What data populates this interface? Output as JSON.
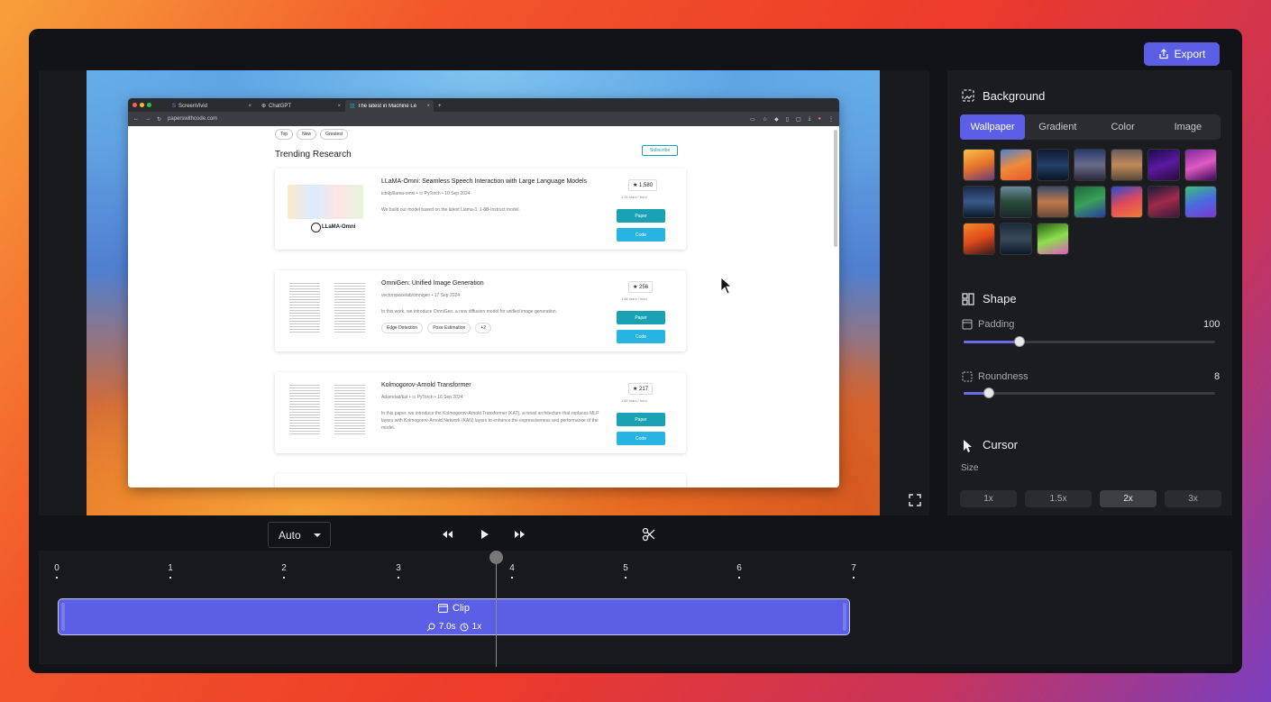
{
  "toolbar": {
    "export_label": "Export"
  },
  "browser": {
    "tabs": [
      {
        "label": "ScreenVivid",
        "icon": "screenvivid-icon"
      },
      {
        "label": "ChatGPT",
        "icon": "chatgpt-icon"
      },
      {
        "label": "The latest in Machine Le",
        "icon": "pwc-icon"
      }
    ],
    "url": "paperswithcode.com"
  },
  "page": {
    "filters": [
      "Top",
      "New",
      "Greatest"
    ],
    "heading": "Trending Research",
    "subscribe": "Subscribe",
    "papers": [
      {
        "title": "LLaMA-Omni: Seamless Speech Interaction with Large Language Models",
        "meta": "ictnlp/llama-omni • ⊙ PyTorch • 10 Sep 2024",
        "desc": "We build our model based on the latest Llama-3. 1-8B-Instruct model.",
        "stars": "1,580",
        "stars_rate": "1.93 stars / hour",
        "tags": [],
        "logo_text": "LLaMA-Omni"
      },
      {
        "title": "OmniGen: Unified Image Generation",
        "meta": "vectorspacelab/omnigen • 17 Sep 2024",
        "desc": "In this work, we introduce OmniGen, a new diffusion model for unified image generation.",
        "stars": "256",
        "stars_rate": "1.86 stars / hour",
        "tags": [
          "Edge Detection",
          "Pose Estimation",
          "+2"
        ]
      },
      {
        "title": "Kolmogorov-Arnold Transformer",
        "meta": "Adamdad/kat • ⊙ PyTorch • 16 Sep 2024",
        "desc": "In this paper, we introduce the Kolmogorov-Arnold Transformer (KAT), a novel architecture that replaces MLP layers with Kolmogorov-Arnold Network (KAN) layers to enhance the expressiveness and performance of the model.",
        "stars": "217",
        "stars_rate": "1.60 stars / hour",
        "tags": []
      }
    ],
    "paper_btn": "Paper",
    "code_btn": "Code"
  },
  "panel": {
    "background": {
      "title": "Background",
      "tabs": [
        "Wallpaper",
        "Gradient",
        "Color",
        "Image"
      ],
      "active_tab": "Wallpaper"
    },
    "shape": {
      "title": "Shape",
      "padding_label": "Padding",
      "padding_value": "100",
      "padding_fraction": 0.22,
      "roundness_label": "Roundness",
      "roundness_value": "8",
      "roundness_fraction": 0.1
    },
    "cursor": {
      "title": "Cursor",
      "size_label": "Size",
      "sizes": [
        "1x",
        "1.5x",
        "2x",
        "3x"
      ],
      "active_size": "2x"
    }
  },
  "controls": {
    "speed_select": "Auto"
  },
  "timeline": {
    "ticks": [
      "0",
      "1",
      "2",
      "3",
      "4",
      "5",
      "6",
      "7"
    ],
    "clip_label": "Clip",
    "clip_duration": "7.0s",
    "clip_speed": "1x"
  },
  "colors": {
    "accent": "#5b5fe6",
    "teal": "#1aa1b3"
  }
}
